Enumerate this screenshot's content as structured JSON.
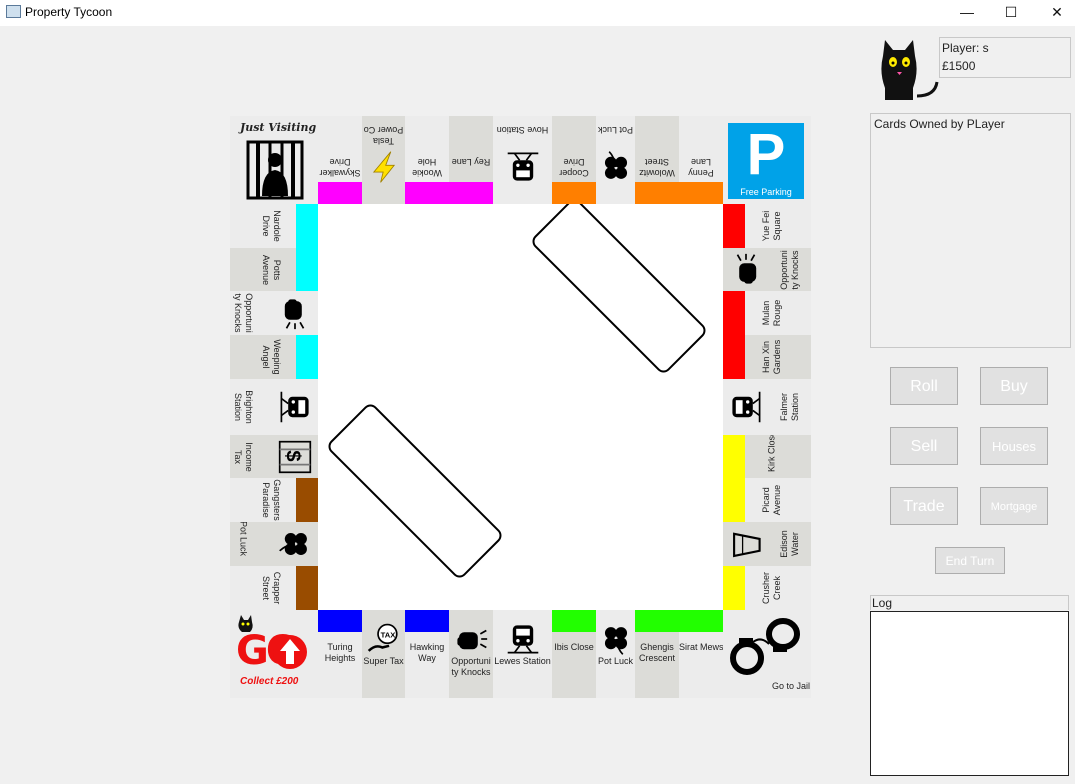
{
  "window": {
    "title": "Property Tycoon",
    "minimize": "—",
    "maximize": "☐",
    "close": "✕"
  },
  "player": {
    "name_label": "Player: s",
    "money": "£1500",
    "icon": "black-cat-icon"
  },
  "cards_panel": {
    "title": "Cards Owned by PLayer"
  },
  "buttons": {
    "roll": "Roll",
    "buy": "Buy",
    "sell": "Sell",
    "houses": "Houses",
    "trade": "Trade",
    "mortgage": "Mortgage",
    "end_turn": "End Turn"
  },
  "log": {
    "label": "Log"
  },
  "board": {
    "corners": {
      "jail": {
        "label": "Just Visiting",
        "icon": "jail-icon"
      },
      "parking": {
        "label": "Free Parking",
        "letter": "P",
        "icon": "parking-icon"
      },
      "go": {
        "label": "GO",
        "sub": "Collect £200",
        "icon": "go-arrow-icon"
      },
      "go_to_jail": {
        "label": "Go to Jail",
        "icon": "handcuffs-icon"
      }
    },
    "colors": {
      "pink": "#ff00ff",
      "orange": "#ff7f00",
      "red": "#ff0000",
      "yellow": "#ffff00",
      "green": "#22ff00",
      "blue": "#0000ff",
      "cyan": "#00ffff",
      "brown": "#994c00",
      "parking": "#00a2e8",
      "go": "#ee1111"
    },
    "top": [
      {
        "name": "Skywalker Drive",
        "color": "pink"
      },
      {
        "name": "Tesla Power Co",
        "icon": "lightning-icon"
      },
      {
        "name": "Wookie Hole",
        "color": "pink"
      },
      {
        "name": "Rey Lane",
        "color": "pink"
      },
      {
        "name": "Hove Station",
        "icon": "train-icon"
      },
      {
        "name": "Cooper Drive",
        "color": "orange"
      },
      {
        "name": "Pot Luck",
        "icon": "clover-icon"
      },
      {
        "name": "Wolowitz Street",
        "color": "orange"
      },
      {
        "name": "Penny Lane",
        "color": "orange"
      }
    ],
    "right": [
      {
        "name": "Yue Fei Square",
        "color": "red"
      },
      {
        "name": "Opportunity Knocks",
        "icon": "fist-icon"
      },
      {
        "name": "Mulan Rouge",
        "color": "red"
      },
      {
        "name": "Han Xin Gardens",
        "color": "red"
      },
      {
        "name": "Falmer Station",
        "icon": "train-icon"
      },
      {
        "name": "Kirk Close",
        "color": "yellow"
      },
      {
        "name": "Picard Avenue",
        "color": "yellow"
      },
      {
        "name": "Edison Water",
        "icon": "water-glass-icon"
      },
      {
        "name": "Crusher Creek",
        "color": "yellow"
      }
    ],
    "bottom": [
      {
        "name": "Turing Heights",
        "color": "blue"
      },
      {
        "name": "Super Tax",
        "icon": "tax-icon"
      },
      {
        "name": "Hawking Way",
        "color": "blue"
      },
      {
        "name": "Opportunity Knocks",
        "icon": "fist-icon"
      },
      {
        "name": "Lewes Station",
        "icon": "train-icon"
      },
      {
        "name": "Ibis Close",
        "color": "green"
      },
      {
        "name": "Pot Luck",
        "icon": "clover-icon"
      },
      {
        "name": "Ghengis Crescent",
        "color": "green"
      },
      {
        "name": "Sirat Mews",
        "color": "green"
      }
    ],
    "left": [
      {
        "name": "Nardole Drive",
        "color": "cyan"
      },
      {
        "name": "Potts Avenue",
        "color": "cyan"
      },
      {
        "name": "Opportunity Knocks",
        "icon": "fist-icon"
      },
      {
        "name": "Weeping Angel",
        "color": "cyan"
      },
      {
        "name": "Brighton Station",
        "icon": "train-icon"
      },
      {
        "name": "Income Tax",
        "icon": "dollar-cage-icon"
      },
      {
        "name": "Gangsters Paradise",
        "color": "brown"
      },
      {
        "name": "Pot Luck",
        "icon": "clover-icon"
      },
      {
        "name": "Crapper Street",
        "color": "brown"
      }
    ],
    "center": {
      "card_decks": [
        "opportunity-knocks-deck",
        "pot-luck-deck"
      ]
    }
  },
  "labels": {
    "top": [
      "Skywalker\nDrive",
      "Tesla\nPower Co",
      "Wookie\nHole",
      "Rey Lane",
      "Hove Station",
      "Cooper\nDrive",
      "Pot Luck",
      "Wolowitz\nStreet",
      "Penny\nLane"
    ],
    "right": [
      "Yue Fei\nSquare",
      "Opportuni\nty Knocks",
      "Mulan\nRouge",
      "Han Xin\nGardens",
      "Falmer\nStation",
      "Kirk Close",
      "Picard\nAvenue",
      "Edison\nWater",
      "Crusher\nCreek"
    ],
    "bottom": [
      "Turing\nHeights",
      "Super Tax",
      "Hawking\nWay",
      "Opportuni\nty Knocks",
      "Lewes Station",
      "Ibis Close",
      "Pot Luck",
      "Ghengis\nCrescent",
      "Sirat Mews"
    ],
    "left": [
      "Nardole\nDrive",
      "Potts\nAvenue",
      "Opportuni\nty Knocks",
      "Weeping\nAngel",
      "Brighton\nStation",
      "Income\nTax",
      "Gangsters\nParadise",
      "Pot Luck",
      "Crapper\nStreet"
    ]
  }
}
